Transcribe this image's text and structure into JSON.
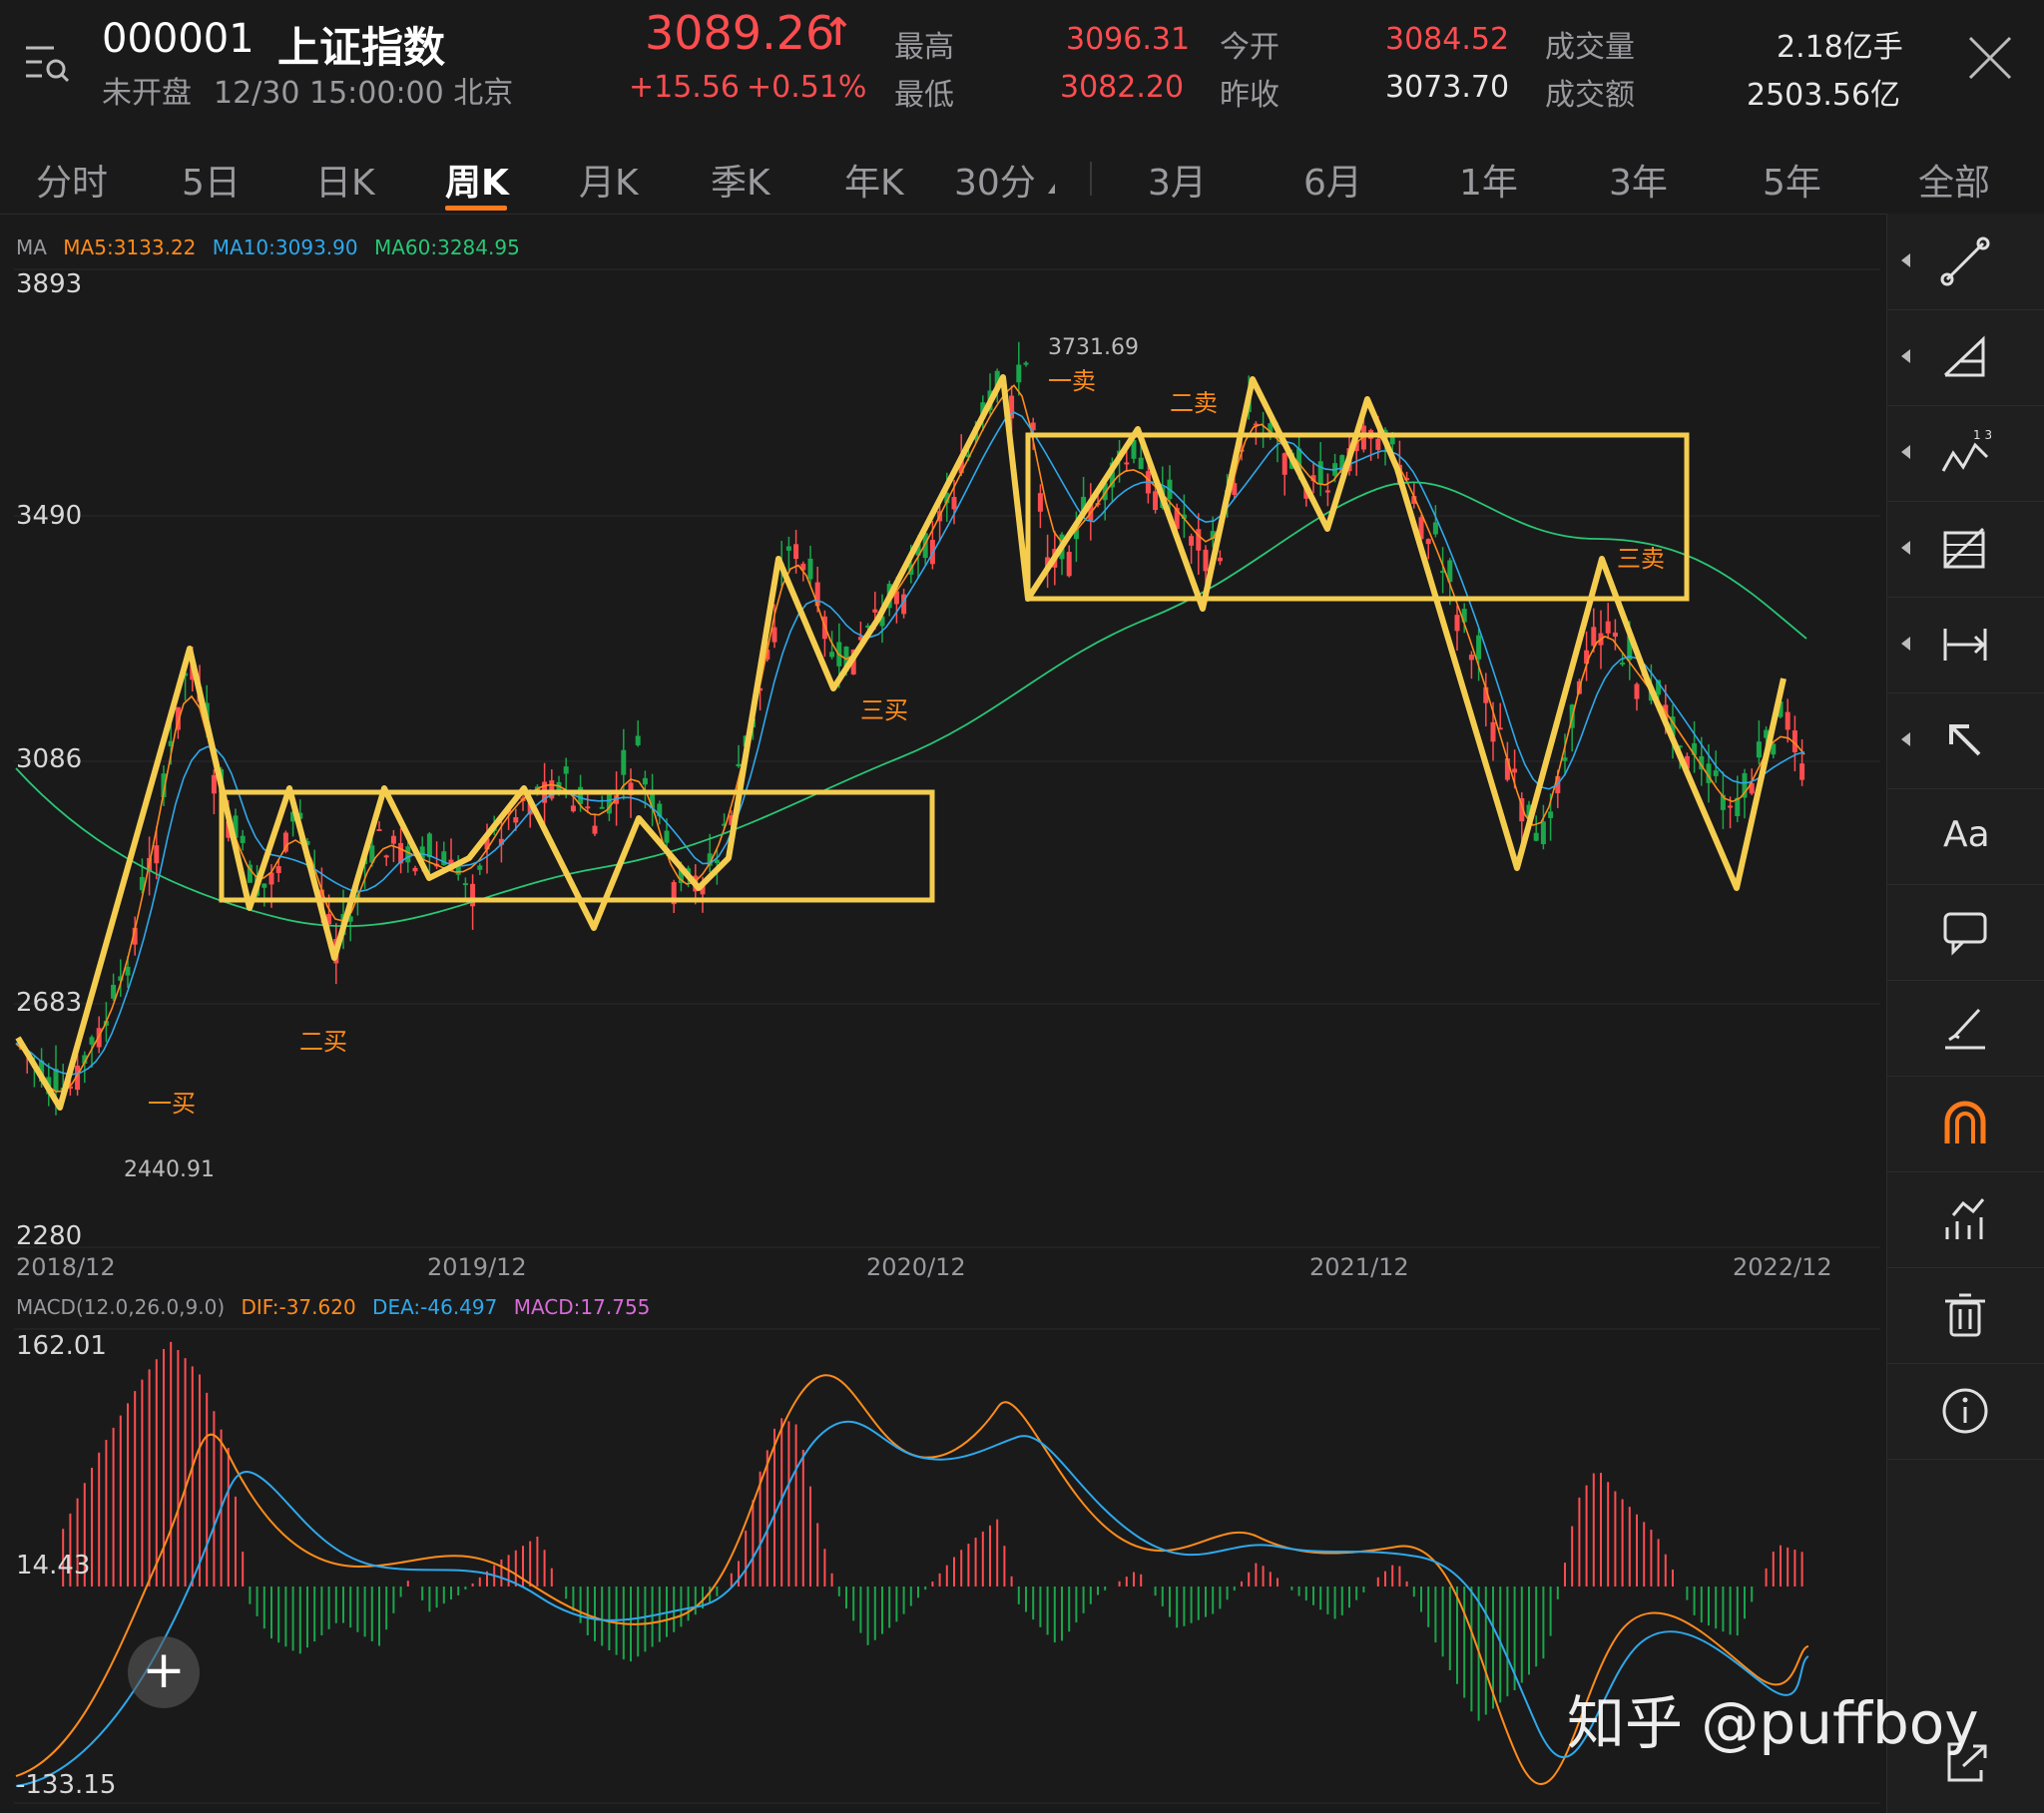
{
  "header": {
    "code": "000001",
    "name": "上证指数",
    "status": "未开盘",
    "datetime": "12/30 15:00:00 北京",
    "price": "3089.26",
    "price_arrow": "↑",
    "change": "+15.56",
    "change_pct": "+0.51%",
    "stats": [
      {
        "label": "最高",
        "value": "3096.31",
        "color": "#ff4d4f"
      },
      {
        "label": "最低",
        "value": "3082.20",
        "color": "#ff4d4f"
      },
      {
        "label": "今开",
        "value": "3084.52",
        "color": "#ff4d4f"
      },
      {
        "label": "昨收",
        "value": "3073.70",
        "color": "#e8e8e8"
      },
      {
        "label": "成交量",
        "value": "2.18亿手",
        "color": "#e8e8e8"
      },
      {
        "label": "成交额",
        "value": "2503.56亿",
        "color": "#e8e8e8"
      }
    ],
    "menu_icon": "menu-search-icon",
    "close_icon": "close-icon"
  },
  "tabs": [
    {
      "label": "分时"
    },
    {
      "label": "5日"
    },
    {
      "label": "日K"
    },
    {
      "label": "周K",
      "active": true
    },
    {
      "label": "月K"
    },
    {
      "label": "季K"
    },
    {
      "label": "年K"
    },
    {
      "label": "30分"
    },
    {
      "label": "3月"
    },
    {
      "label": "6月"
    },
    {
      "label": "1年"
    },
    {
      "label": "3年"
    },
    {
      "label": "5年"
    },
    {
      "label": "全部"
    }
  ],
  "main_chart": {
    "ma_prefix": "MA",
    "ma_items": [
      {
        "text": "MA5:3133.22",
        "color": "#ff8c1a"
      },
      {
        "text": "MA10:3093.90",
        "color": "#2fa8ea"
      },
      {
        "text": "MA60:3284.95",
        "color": "#29c774"
      }
    ],
    "y_ticks": [
      "3893",
      "3490",
      "3086",
      "2683",
      "2280"
    ],
    "x_ticks": [
      "2018/12",
      "2019/12",
      "2020/12",
      "2021/12",
      "2022/12"
    ],
    "high_label": "3731.69",
    "low_label": "2440.91",
    "annotations": [
      {
        "text": "一买",
        "color": "#ff8c1a"
      },
      {
        "text": "二买",
        "color": "#ff8c1a"
      },
      {
        "text": "三买",
        "color": "#ff8c1a"
      },
      {
        "text": "一卖",
        "color": "#ff8c1a"
      },
      {
        "text": "二卖",
        "color": "#ff8c1a"
      },
      {
        "text": "三卖",
        "color": "#ff8c1a"
      }
    ]
  },
  "macd_chart": {
    "title": "MACD(12.0,26.0,9.0)",
    "items": [
      {
        "text": "DIF:-37.620",
        "color": "#ff8c1a"
      },
      {
        "text": "DEA:-46.497",
        "color": "#2fa8ea"
      },
      {
        "text": "MACD:17.755",
        "color": "#d86bd8"
      }
    ],
    "y_ticks": [
      "162.01",
      "14.43",
      "-133.15"
    ]
  },
  "toolbar": [
    {
      "icon": "line-draw-icon"
    },
    {
      "icon": "triangle-draw-icon"
    },
    {
      "icon": "wave-123-icon"
    },
    {
      "icon": "fib-grid-icon"
    },
    {
      "icon": "range-measure-icon"
    },
    {
      "icon": "arrow-icon"
    },
    {
      "icon": "text-icon",
      "label": "Aa"
    },
    {
      "icon": "comment-icon"
    },
    {
      "icon": "pen-icon"
    },
    {
      "icon": "magnet-icon"
    },
    {
      "icon": "chart-tool-icon"
    },
    {
      "icon": "trash-icon"
    },
    {
      "icon": "info-icon"
    }
  ],
  "watermark": "知乎 @puffboy",
  "colors": {
    "up": "#ff4d4f",
    "down": "#1aa64a",
    "annotation": "#f5cd4e",
    "accent": "#ff7a1a"
  }
}
